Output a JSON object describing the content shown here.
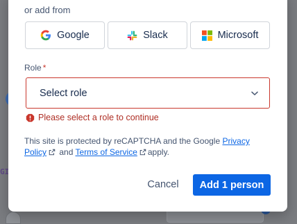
{
  "background": {
    "partial_text": "GI"
  },
  "modal": {
    "or_add_from": "or add from",
    "providers": [
      {
        "label": "Google",
        "icon": "google-logo"
      },
      {
        "label": "Slack",
        "icon": "slack-logo"
      },
      {
        "label": "Microsoft",
        "icon": "microsoft-logo"
      }
    ],
    "role_field": {
      "label": "Role",
      "required_marker": "*",
      "value": "Select role",
      "error_icon": "error-icon",
      "error_text": "Please select a role to continue"
    },
    "recaptcha": {
      "prefix": "This site is protected by reCAPTCHA and the Google",
      "privacy_link": "Privacy Policy",
      "and": "and",
      "terms_link": "Terms of Service",
      "suffix": "apply."
    },
    "footer": {
      "cancel_label": "Cancel",
      "submit_label": "Add 1 person"
    }
  },
  "colors": {
    "primary": "#0c66e4",
    "error": "#c9372c",
    "overlay": "#7a7c80"
  }
}
